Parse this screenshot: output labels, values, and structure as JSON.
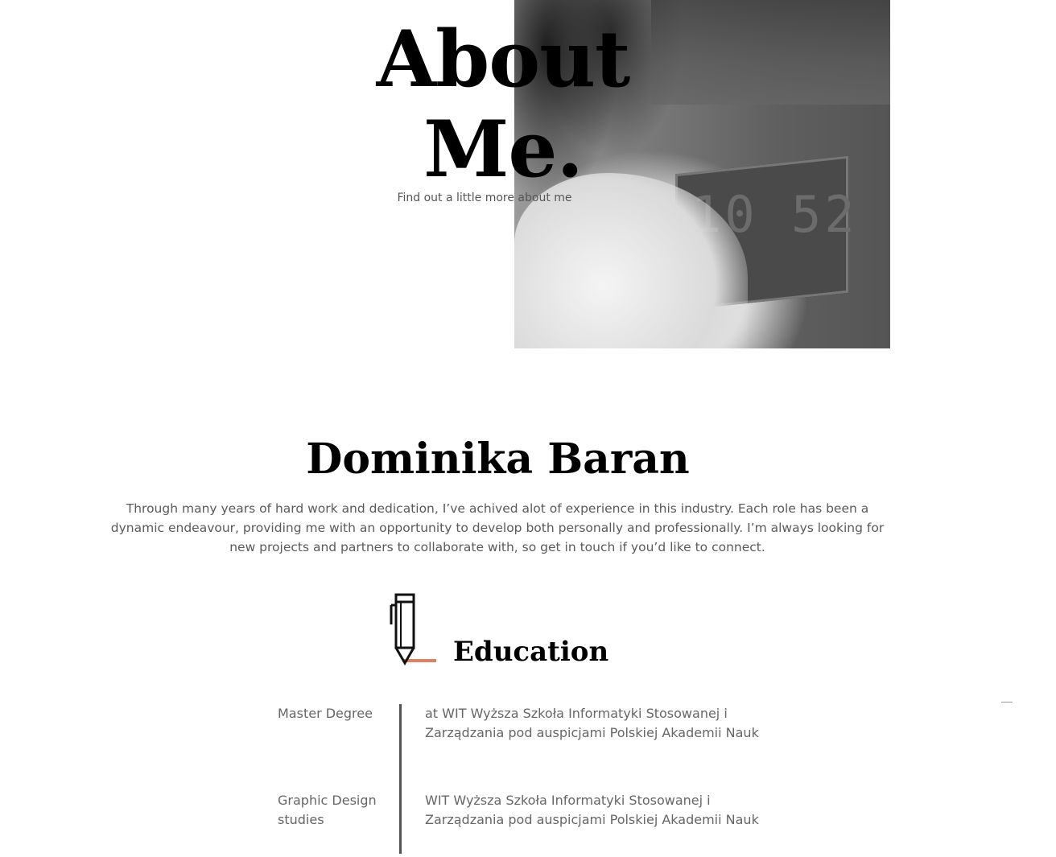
{
  "hero": {
    "title_line1": "About",
    "title_line2": "Me.",
    "subtitle": "Find out a little more about me",
    "photo_clock_text": "10 52"
  },
  "profile": {
    "name": "Dominika Baran",
    "bio": "Through many years of hard work and dedication, I’ve achived alot of experience in this industry. Each role has been a dynamic endeavour, providing me with an opportunity to develop both personally and professionally. I’m always looking for new projects and partners to collaborate with, so get in touch if you’d like to connect."
  },
  "education": {
    "icon": "pencil-icon",
    "heading": "Education",
    "accent_color": "#e0805f",
    "items": [
      {
        "degree": "Master Degree",
        "school": "at WIT Wyższa Szkoła Informatyki Stosowanej i Zarządzania pod auspicjami Polskiej Akademii Nauk"
      },
      {
        "degree": "Graphic Design studies",
        "school": "WIT Wyższa Szkoła Informatyki Stosowanej i Zarządzania pod auspicjami Polskiej Akademii Nauk"
      }
    ]
  }
}
